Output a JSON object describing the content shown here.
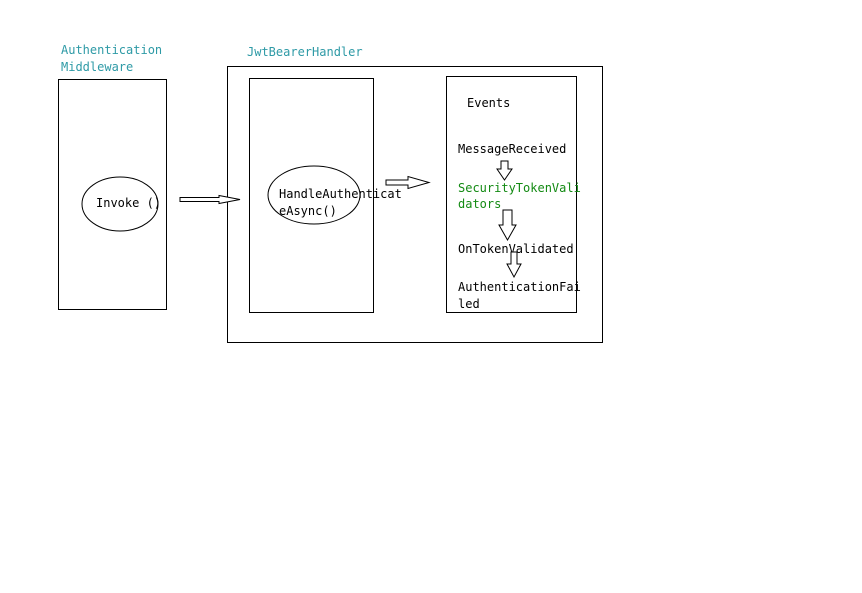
{
  "middleware": {
    "label_line1": "Authentication",
    "label_line2": "Middleware",
    "method": "Invoke ()"
  },
  "handler": {
    "label": "JwtBearerHandler",
    "method_line1": "HandleAuthenticat",
    "method_line2": "eAsync()"
  },
  "events": {
    "title": "Events",
    "items": [
      {
        "line1": "MessageReceived",
        "line2": ""
      },
      {
        "line1": "SecurityTokenVali",
        "line2": "dators"
      },
      {
        "line1": "OnTokenValidated",
        "line2": ""
      },
      {
        "line1": "AuthenticationFai",
        "line2": "led"
      }
    ]
  },
  "colors": {
    "label_teal": "#2e9aa6",
    "highlight_green": "#138a13"
  }
}
